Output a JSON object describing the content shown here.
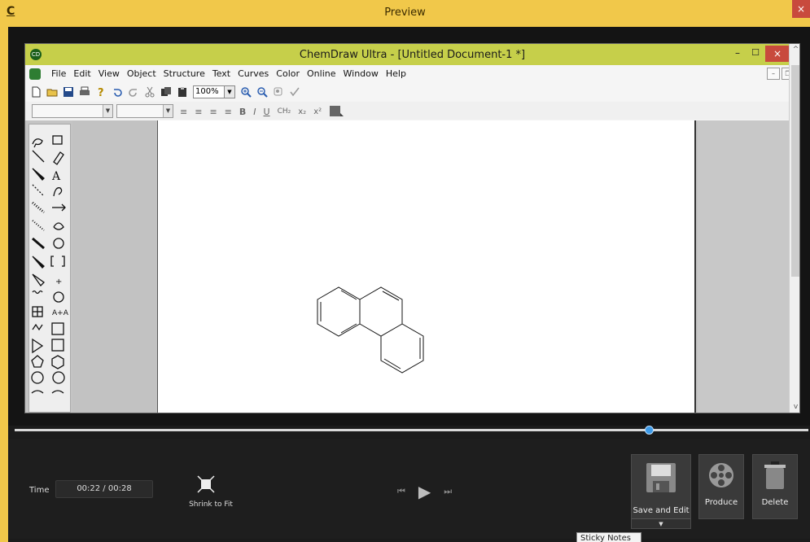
{
  "outer_window": {
    "title": "Preview",
    "logo": "C",
    "close": "×"
  },
  "chemdraw": {
    "title": "ChemDraw Ultra - [Untitled Document-1 *]",
    "logo": "CD",
    "minimize": "–",
    "maximize": "☐",
    "close": "×",
    "menu": [
      "File",
      "Edit",
      "View",
      "Object",
      "Structure",
      "Text",
      "Curves",
      "Color",
      "Online",
      "Window",
      "Help"
    ],
    "zoom_value": "100%",
    "zoom_dropdown": "▼",
    "combo_dropdown": "▼",
    "toolbar_icons": [
      "new-doc-icon",
      "open-icon",
      "save-icon",
      "print-icon",
      "help-icon",
      "undo-icon",
      "redo-icon",
      "cut-icon",
      "copy-icon",
      "paste-icon",
      "zoom-in-icon",
      "zoom-out-icon",
      "show-icon",
      "check-icon"
    ],
    "format_icons": [
      "≡",
      "≡",
      "≡",
      "≡",
      "B",
      "I",
      "U",
      "CH₂",
      "x₂",
      "x²"
    ],
    "scroll_up": "^",
    "scroll_down": "v",
    "win_min": "–",
    "win_restore": "❐"
  },
  "player": {
    "time_label": "Time",
    "time_value": "00:22  /  00:28",
    "progress_fraction": 0.8,
    "shrink_label": "Shrink to Fit",
    "prev": "⏮",
    "play": "▶",
    "next": "⏭",
    "save_edit_label": "Save and Edit",
    "save_edit_arrow": "▼",
    "produce_label": "Produce",
    "delete_label": "Delete",
    "tooltip": "Sticky Notes"
  },
  "colors": {
    "outer_titlebar": "#f1c84a",
    "chemdraw_titlebar": "#c6cf4a",
    "progress_knob": "#3d9ae8",
    "close_red": "#c84a3d"
  }
}
